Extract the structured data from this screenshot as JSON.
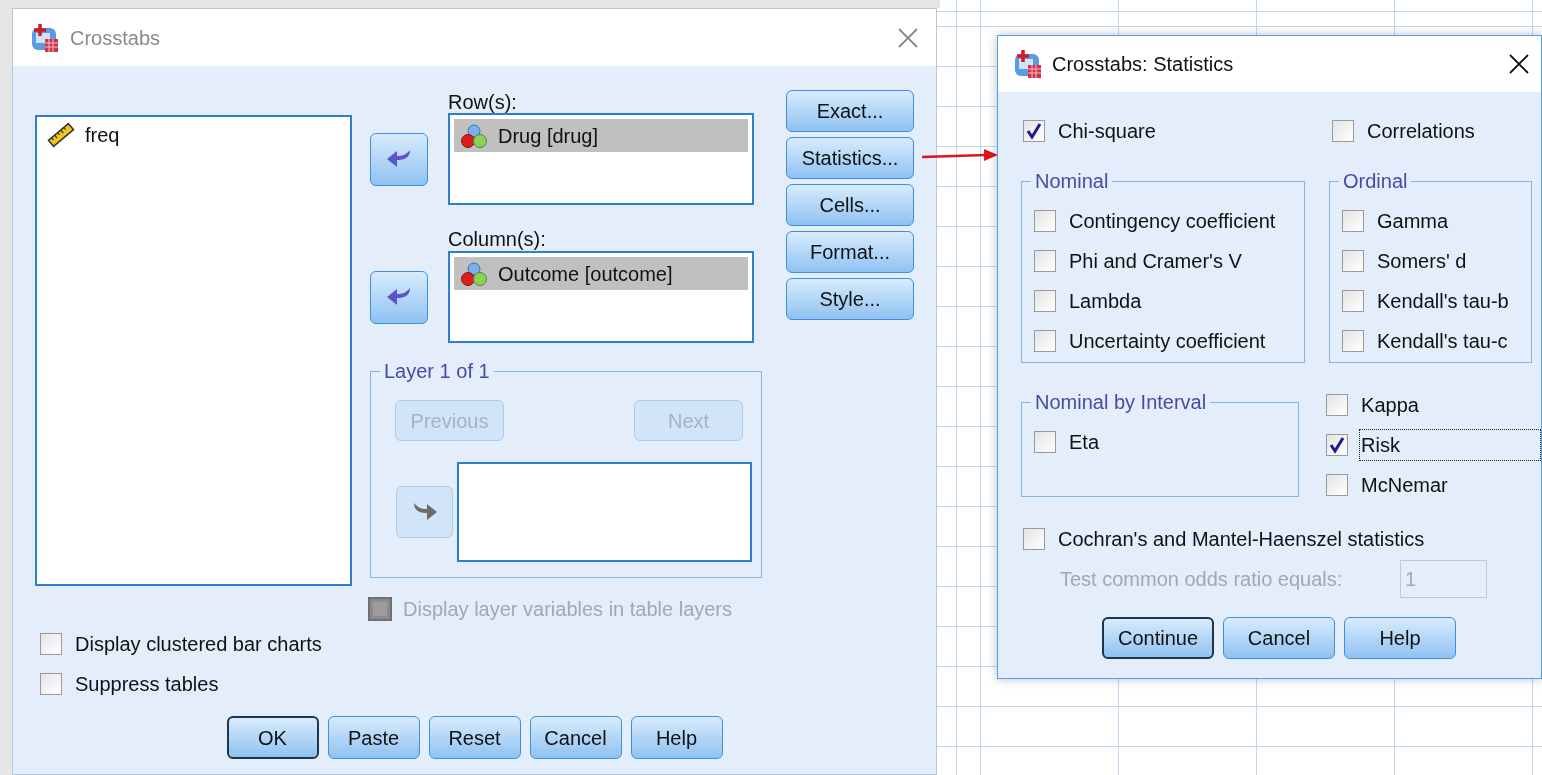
{
  "main_dialog": {
    "title": "Crosstabs",
    "active": false,
    "variables": [
      {
        "name": "freq",
        "kind": "scale",
        "selected": false
      }
    ],
    "rows": {
      "label": "Row(s):",
      "items": [
        {
          "name": "Drug [drug]",
          "kind": "nominal",
          "selected": true
        }
      ]
    },
    "columns": {
      "label": "Column(s):",
      "items": [
        {
          "name": "Outcome [outcome]",
          "kind": "nominal",
          "selected": true
        }
      ]
    },
    "layer": {
      "title": "Layer 1 of 1",
      "previous": {
        "label": "Previous",
        "disabled": true
      },
      "next": {
        "label": "Next",
        "disabled": true
      },
      "move_disabled": true
    },
    "display_layer": {
      "label": "Display layer variables in table layers",
      "checked": false,
      "disabled": true
    },
    "side_buttons": [
      "Exact...",
      "Statistics...",
      "Cells...",
      "Format...",
      "Style..."
    ],
    "options": [
      {
        "label": "Display clustered bar charts",
        "checked": false
      },
      {
        "label": "Suppress tables",
        "checked": false
      }
    ],
    "buttons": [
      {
        "label": "OK",
        "default": true
      },
      {
        "label": "Paste",
        "default": false
      },
      {
        "label": "Reset",
        "default": false
      },
      {
        "label": "Cancel",
        "default": false
      },
      {
        "label": "Help",
        "default": false
      }
    ]
  },
  "statistics_dialog": {
    "title": "Crosstabs: Statistics",
    "active": true,
    "chi_square": {
      "label": "Chi-square",
      "checked": true
    },
    "correlations": {
      "label": "Correlations",
      "checked": false
    },
    "nominal": {
      "title": "Nominal",
      "items": [
        {
          "label": "Contingency coefficient",
          "checked": false
        },
        {
          "label": "Phi and Cramer's V",
          "checked": false
        },
        {
          "label": "Lambda",
          "checked": false
        },
        {
          "label": "Uncertainty coefficient",
          "checked": false
        }
      ]
    },
    "ordinal": {
      "title": "Ordinal",
      "items": [
        {
          "label": "Gamma",
          "checked": false
        },
        {
          "label": "Somers' d",
          "checked": false
        },
        {
          "label": "Kendall's tau-b",
          "checked": false
        },
        {
          "label": "Kendall's tau-c",
          "checked": false
        }
      ]
    },
    "nominal_by_interval": {
      "title": "Nominal by Interval",
      "items": [
        {
          "label": "Eta",
          "checked": false
        }
      ]
    },
    "agreement": [
      {
        "label": "Kappa",
        "checked": false,
        "focused": false
      },
      {
        "label": "Risk",
        "checked": true,
        "focused": true
      },
      {
        "label": "McNemar",
        "checked": false,
        "focused": false
      }
    ],
    "cochran": {
      "label": "Cochran's and Mantel-Haenszel statistics",
      "checked": false
    },
    "odds_ratio": {
      "label": "Test common odds ratio equals:",
      "value": "1",
      "disabled": true
    },
    "buttons": [
      {
        "label": "Continue",
        "default": true
      },
      {
        "label": "Cancel",
        "default": false
      },
      {
        "label": "Help",
        "default": false
      }
    ]
  }
}
